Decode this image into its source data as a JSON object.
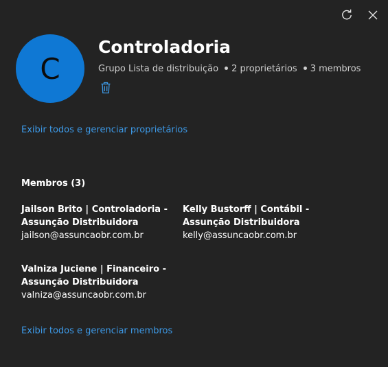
{
  "icons": {
    "refresh": "refresh-icon",
    "close": "close-icon",
    "delete": "trash-icon"
  },
  "colors": {
    "background": "#232323",
    "avatar": "#0f78d4",
    "link": "#3d9ae8"
  },
  "group": {
    "initial": "C",
    "name": "Controladoria",
    "type": "Grupo Lista de distribuição",
    "owners_count": "2 proprietários",
    "members_count": "3 membros"
  },
  "owners_link": "Exibir todos e gerenciar proprietários",
  "members_section": {
    "heading": "Membros (3)",
    "members": [
      {
        "name": "Jailson Brito | Controladoria - Assunção Distribuidora",
        "email": "jailson@assuncaobr.com.br"
      },
      {
        "name": "Kelly Bustorff | Contábil - Assunção Distribuidora",
        "email": "kelly@assuncaobr.com.br"
      },
      {
        "name": "Valniza Juciene | Financeiro - Assunção Distribuidora",
        "email": "valniza@assuncaobr.com.br"
      }
    ],
    "manage_link": "Exibir todos e gerenciar membros"
  }
}
